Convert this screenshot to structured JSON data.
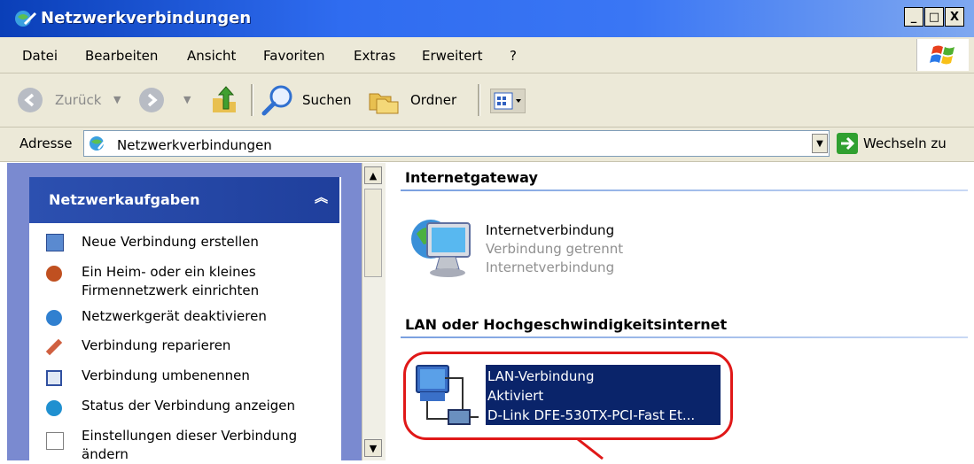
{
  "window": {
    "title": "Netzwerkverbindungen",
    "minimize": "_",
    "maximize": "□",
    "close": "X"
  },
  "menu": [
    "Datei",
    "Bearbeiten",
    "Ansicht",
    "Favoriten",
    "Extras",
    "Erweitert",
    "?"
  ],
  "toolbar": {
    "back": "Zurück",
    "search": "Suchen",
    "folders": "Ordner"
  },
  "address": {
    "label": "Adresse",
    "value": "Netzwerkverbindungen",
    "go": "Wechseln zu"
  },
  "tasks": {
    "header": "Netzwerkaufgaben",
    "items": [
      {
        "line1": "Neue Verbindung erstellen",
        "line2": ""
      },
      {
        "line1": "Ein Heim- oder ein kleines",
        "line2": "Firmennetzwerk einrichten"
      },
      {
        "line1": "Netzwerkgerät deaktivieren",
        "line2": ""
      },
      {
        "line1": "Verbindung reparieren",
        "line2": ""
      },
      {
        "line1": "Verbindung umbenennen",
        "line2": ""
      },
      {
        "line1": "Status der Verbindung anzeigen",
        "line2": ""
      },
      {
        "line1": "Einstellungen dieser Verbindung",
        "line2": "ändern"
      }
    ]
  },
  "groups": {
    "gateway": {
      "title": "Internetgateway",
      "name": "Internetverbindung",
      "status": "Verbindung getrennt",
      "type": "Internetverbindung"
    },
    "lan": {
      "title": "LAN oder Hochgeschwindigkeitsinternet",
      "name": "LAN-Verbindung",
      "status": "Aktiviert",
      "device": "D-Link DFE-530TX-PCI-Fast Et..."
    }
  },
  "colors": {
    "titlebar": "#2f6cf0",
    "chrome": "#ece9d8",
    "selection": "#0a246a",
    "highlight_outline": "#e01818"
  }
}
